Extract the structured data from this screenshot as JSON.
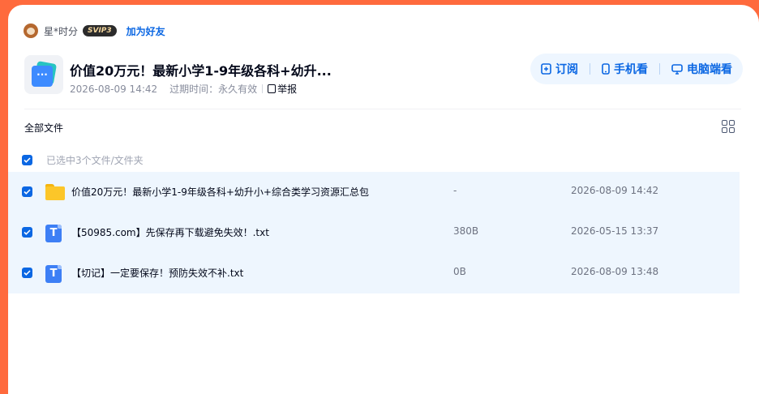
{
  "user": {
    "name": "星*时分",
    "vip_badge": "SVIP3",
    "add_friend_label": "加为好友"
  },
  "share": {
    "title": "价值20万元！最新小学1-9年级各科+幼升...",
    "created": "2026-08-09 14:42",
    "expire_label": "过期时间：",
    "expire_value": "永久有效",
    "report_label": "举报"
  },
  "actions": {
    "subscribe": "订阅",
    "phone": "手机看",
    "pc": "电脑端看"
  },
  "breadcrumb": "全部文件",
  "selection_text": "已选中3个文件/文件夹",
  "files": [
    {
      "name": "价值20万元！最新小学1-9年级各科+幼升小+综合类学习资源汇总包",
      "size": "-",
      "time": "2026-08-09 14:42",
      "type": "folder",
      "checked": true
    },
    {
      "name": "【50985.com】先保存再下载避免失效！.txt",
      "size": "380B",
      "time": "2026-05-15 13:37",
      "type": "txt",
      "checked": true
    },
    {
      "name": "【切记】一定要保存！预防失效不补.txt",
      "size": "0B",
      "time": "2026-08-09 13:48",
      "type": "txt",
      "checked": true
    }
  ],
  "icons": {
    "folder": "folder-icon",
    "txt": "txt-file-icon",
    "grid": "grid-view-icon"
  },
  "colors": {
    "accent": "#0b67e3",
    "background": "#ff6a3d",
    "row_highlight": "#eef6fe"
  }
}
